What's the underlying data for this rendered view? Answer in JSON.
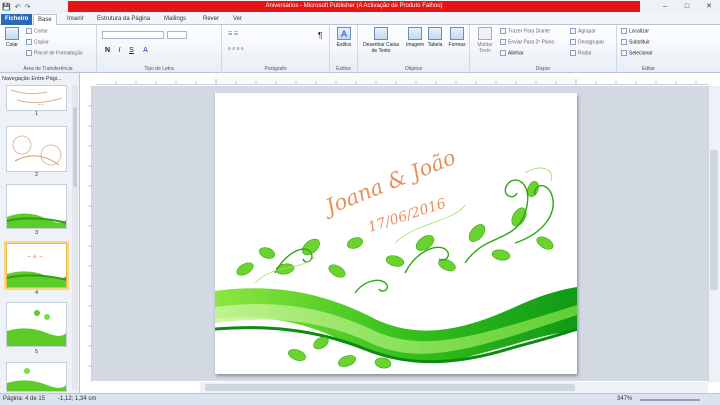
{
  "window": {
    "title": "Aniversarios - Microsoft Publisher (A Activação de Produto Falhou)",
    "minimize": "–",
    "maximize": "□",
    "close": "✕"
  },
  "qat": {
    "save": "💾",
    "undo": "↶",
    "redo": "↷"
  },
  "tabs": [
    {
      "label": "Ficheiro"
    },
    {
      "label": "Base"
    },
    {
      "label": "Inserir"
    },
    {
      "label": "Estrutura da Página"
    },
    {
      "label": "Mailings"
    },
    {
      "label": "Rever"
    },
    {
      "label": "Ver"
    }
  ],
  "ribbon": {
    "clipboard": {
      "paste": "Colar",
      "cut": "Cortar",
      "copy": "Copiar",
      "format_painter": "Pincel de Formatação",
      "group": "Área de Transferência"
    },
    "font": {
      "bold": "N",
      "italic": "I",
      "underline": "S",
      "group": "Tipo de Letra"
    },
    "paragraph": {
      "group": "Parágrafo"
    },
    "styles": {
      "label": "Estilos",
      "group": "Estilos"
    },
    "objects": {
      "draw_textbox": "Desenhar Caixa de Texto",
      "image": "Imagem",
      "table": "Tabela",
      "shapes": "Formas",
      "group": "Objetos"
    },
    "arrange": {
      "wrap_text": "Moldar Texto",
      "bring_forward": "Trazer Para Diante",
      "send_backward": "Enviar Para 2º Plano",
      "align": "Alinhar",
      "group_btn": "Agrupar",
      "ungroup": "Desagrupar",
      "rotate": "Rodar",
      "group": "Dispor"
    },
    "editing": {
      "find": "Localizar",
      "replace": "Substituir",
      "select": "Selecionar",
      "group": "Editar"
    }
  },
  "nav": {
    "title": "Navegação Entre Pági...",
    "pages": [
      {
        "number": "1"
      },
      {
        "number": "2"
      },
      {
        "number": "3"
      },
      {
        "number": "4"
      },
      {
        "number": "5"
      }
    ]
  },
  "document": {
    "names": "Joana & João",
    "date": "17/06/2016"
  },
  "status": {
    "page": "Página: 4 de 15",
    "position": "-1,12; 1,34 cm",
    "zoom": "347%"
  }
}
